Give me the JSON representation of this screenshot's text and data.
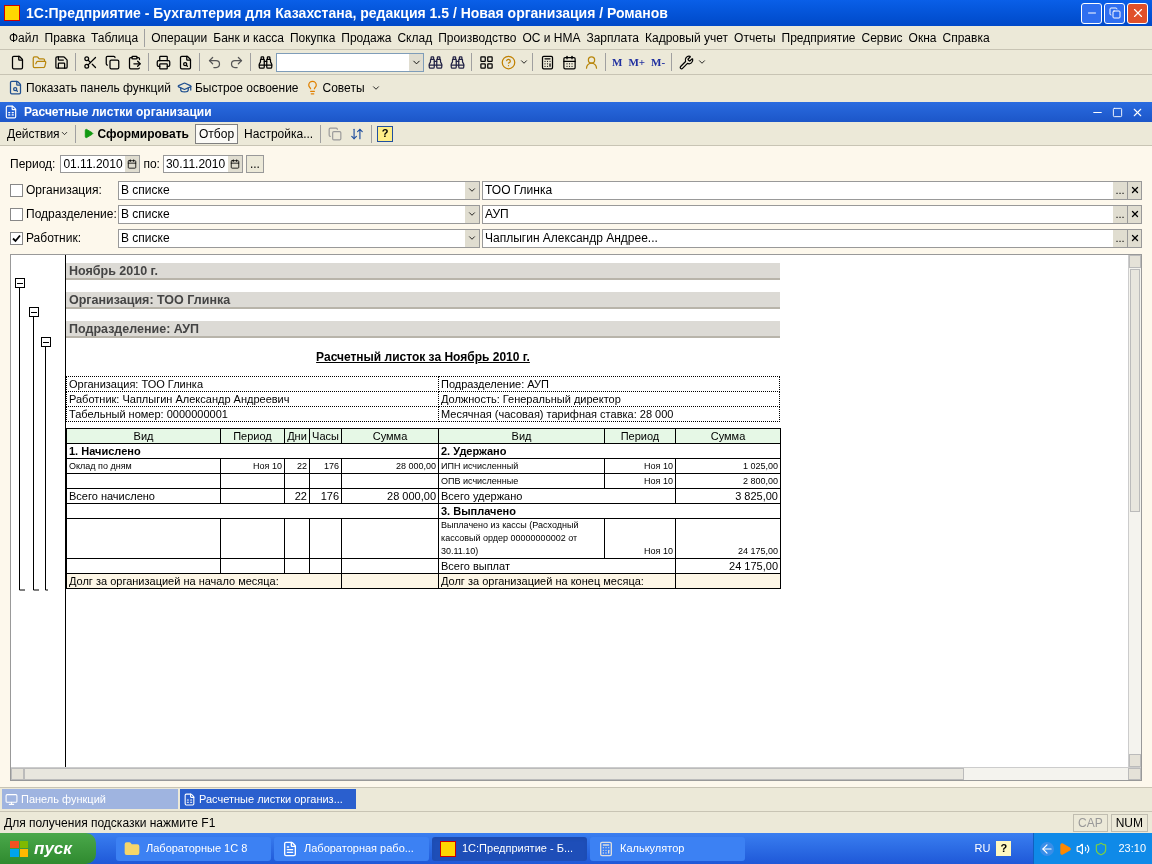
{
  "window": {
    "title": "1С:Предприятие - Бухгалтерия для Казахстана, редакция 1.5 / Новая организация / Романов"
  },
  "menu": [
    "Файл",
    "Правка",
    "Таблица",
    "Операции",
    "Банк и касса",
    "Покупка",
    "Продажа",
    "Склад",
    "Производство",
    "ОС и НМА",
    "Зарплата",
    "Кадровый учет",
    "Отчеты",
    "Предприятие",
    "Сервис",
    "Окна",
    "Справка"
  ],
  "memory_buttons": [
    "M",
    "M+",
    "M-"
  ],
  "quick_panel": [
    "Показать панель функций",
    "Быстрое освоение",
    "Советы"
  ],
  "form": {
    "title": "Расчетные листки организации",
    "actions": {
      "menu": "Действия",
      "generate": "Сформировать",
      "filter": {
        "label": "Отбор",
        "selected": true
      },
      "settings": "Настройка...",
      "help": "?"
    },
    "period": {
      "label": "Период:",
      "from": "01.11.2010",
      "to_label": "по:",
      "to": "30.11.2010",
      "more": "..."
    },
    "filters": [
      {
        "label": "Организация:",
        "checked": false,
        "condition": "В списке",
        "value": "ТОО Глинка",
        "select": "..."
      },
      {
        "label": "Подразделение:",
        "checked": false,
        "condition": "В списке",
        "value": "АУП",
        "select": "..."
      },
      {
        "label": "Работник:",
        "checked": true,
        "condition": "В списке",
        "value": "Чаплыгин Александр Андрее...",
        "select": "..."
      }
    ],
    "report": {
      "groups": [
        "Ноябрь 2010 г.",
        "Организация: ТОО Глинка",
        "Подразделение: АУП"
      ],
      "title": "Расчетный листок за Ноябрь 2010 г.",
      "info": [
        [
          "Организация: ТОО Глинка",
          "Подразделение: АУП"
        ],
        [
          "Работник: Чаплыгин Александр Андреевич",
          "Должность: Генеральный директор"
        ],
        [
          "Табельный номер: 0000000001",
          "Месячная (часовая) тарифная ставка: 28 000"
        ]
      ],
      "rows": [
        {
          "left": {
            "kind": "header",
            "columns": [
              "Вид",
              "Период",
              "Дни",
              "Часы",
              "Сумма"
            ]
          },
          "right": {
            "kind": "header",
            "columns": [
              "Вид",
              "Период",
              "Сумма"
            ]
          }
        },
        {
          "left": {
            "kind": "section",
            "label": "1. Начислено"
          },
          "right": {
            "kind": "section",
            "label": "2. Удержано"
          }
        },
        {
          "left": {
            "kind": "item",
            "label": "Оклад по дням",
            "period": "Ноя 10",
            "days": "22",
            "hours": "176",
            "sum": "28 000,00"
          },
          "right": {
            "kind": "item",
            "label": "ИПН исчисленный",
            "period": "Ноя 10",
            "sum": "1 025,00"
          }
        },
        {
          "left": {
            "kind": "blank"
          },
          "right": {
            "kind": "item",
            "label": "ОПВ исчисленные",
            "period": "Ноя 10",
            "sum": "2 800,00"
          }
        },
        {
          "left": {
            "kind": "total",
            "label": "Всего начислено",
            "days": "22",
            "hours": "176",
            "sum": "28 000,00"
          },
          "right": {
            "kind": "total",
            "label": "Всего удержано",
            "sum": "3 825,00"
          }
        },
        {
          "left": {
            "kind": "merged"
          },
          "right": {
            "kind": "section",
            "label": "3. Выплачено"
          }
        },
        {
          "left": {
            "kind": "blank"
          },
          "right": {
            "kind": "item",
            "label": "Выплачено из кассы (Расходный кассовый ордер 00000000002 от 30.11.10)",
            "period": "Ноя 10",
            "sum": "24 175,00"
          }
        },
        {
          "left": {
            "kind": "blank"
          },
          "right": {
            "kind": "total",
            "label": "Всего выплат",
            "sum": "24 175,00"
          }
        },
        {
          "left": {
            "kind": "debt",
            "label": "Долг за организацией на начало месяца:"
          },
          "right": {
            "kind": "debt",
            "label": "Долг за организацией на конец месяца:"
          }
        }
      ]
    }
  },
  "window_tabs": [
    {
      "label": "Панель функций",
      "selected": false
    },
    {
      "label": "Расчетные листки организ...",
      "selected": true
    }
  ],
  "status_bar": {
    "hint": "Для получения подсказки нажмите F1",
    "indicators": [
      {
        "label": "CAP",
        "on": false
      },
      {
        "label": "NUM",
        "on": true
      }
    ]
  },
  "taskbar": {
    "start": "пуск",
    "items": [
      {
        "label": "Лабораторные 1С 8",
        "kind": "folder",
        "selected": false
      },
      {
        "label": "Лабораторная рабо...",
        "kind": "document",
        "selected": false
      },
      {
        "label": "1С:Предприятие - Б...",
        "kind": "app",
        "selected": true
      },
      {
        "label": "Калькулятор",
        "kind": "calculator",
        "selected": false
      }
    ],
    "lang": "RU",
    "help": "?",
    "clock": "23:10"
  }
}
